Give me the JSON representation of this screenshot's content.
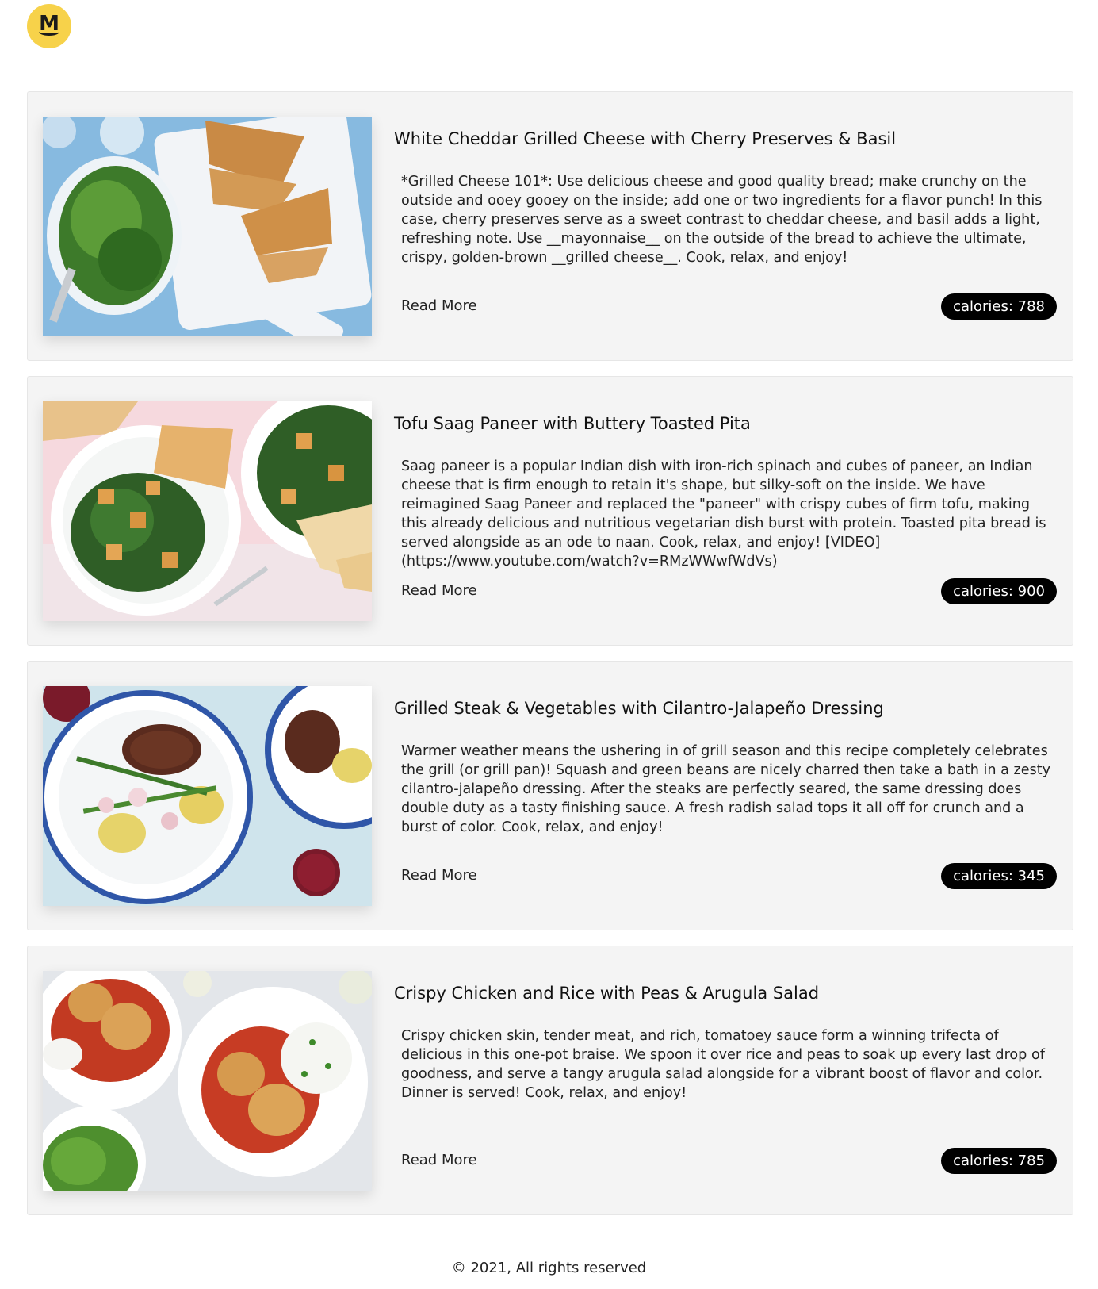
{
  "header": {
    "logo_letter": "M"
  },
  "recipes": [
    {
      "title": "White Cheddar Grilled Cheese with Cherry Preserves & Basil",
      "description": "*Grilled Cheese 101*: Use delicious cheese and good quality bread; make crunchy on the outside and ooey gooey on the inside; add one or two ingredients for a flavor punch! In this case, cherry preserves serve as a sweet contrast to cheddar cheese, and basil adds a light, refreshing note. Use __mayonnaise__ on the outside of the bread to achieve the ultimate, crispy, golden-brown __grilled cheese__. Cook, relax, and enjoy!",
      "read_more": "Read More",
      "calories": "calories: 788",
      "image": "grilled-cheese-photo"
    },
    {
      "title": "Tofu Saag Paneer with Buttery Toasted Pita",
      "description": "Saag paneer is a popular Indian dish with iron-rich spinach and cubes of paneer, an Indian cheese that is firm enough to retain it's shape, but silky-soft on the inside. We have reimagined Saag Paneer and replaced the \"paneer\" with crispy cubes of firm tofu, making this already delicious and nutritious vegetarian dish burst with protein. Toasted pita bread is served alongside as an ode to naan. Cook, relax, and enjoy! [VIDEO](https://www.youtube.com/watch?v=RMzWWwfWdVs)",
      "read_more": "Read More",
      "calories": "calories: 900",
      "image": "saag-paneer-photo"
    },
    {
      "title": "Grilled Steak & Vegetables with Cilantro-Jalapeño Dressing",
      "description": "Warmer weather means the ushering in of grill season and this recipe completely celebrates the grill (or grill pan)! Squash and green beans are nicely charred then take a bath in a zesty cilantro-jalapeño dressing. After the steaks are perfectly seared, the same dressing does double duty as a tasty finishing sauce. A fresh radish salad tops it all off for crunch and a burst of color. Cook, relax, and enjoy!",
      "read_more": "Read More",
      "calories": "calories: 345",
      "image": "grilled-steak-photo"
    },
    {
      "title": "Crispy Chicken and Rice with Peas & Arugula Salad",
      "description": "Crispy chicken skin, tender meat, and rich, tomatoey sauce form a winning trifecta of delicious in this one-pot braise. We spoon it over rice and peas to soak up every last drop of goodness, and serve a tangy arugula salad alongside for a vibrant boost of flavor and color. Dinner is served! Cook, relax, and enjoy!",
      "read_more": "Read More",
      "calories": "calories: 785",
      "image": "crispy-chicken-photo"
    }
  ],
  "footer": {
    "copyright": "© 2021, All rights reserved"
  }
}
